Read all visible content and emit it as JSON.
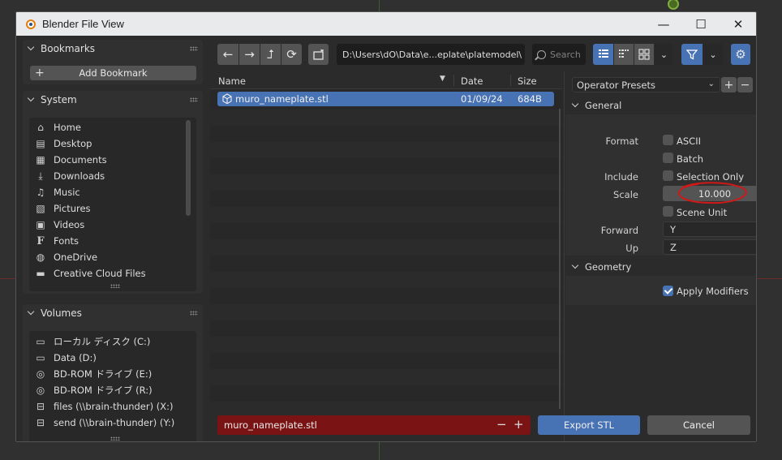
{
  "window": {
    "title": "Blender File View",
    "minimize": "—",
    "maximize": "☐",
    "close": "✕"
  },
  "colors": {
    "accent": "#4772b3",
    "filename_error_bg": "#7a1414",
    "panel_bg": "#303030",
    "annotation_circle": "#d01818"
  },
  "bookmarks": {
    "header": "Bookmarks",
    "add_label": "Add Bookmark"
  },
  "system": {
    "header": "System",
    "items": [
      {
        "label": "Home",
        "icon": "home-icon"
      },
      {
        "label": "Desktop",
        "icon": "desktop-icon"
      },
      {
        "label": "Documents",
        "icon": "documents-icon"
      },
      {
        "label": "Downloads",
        "icon": "download-icon"
      },
      {
        "label": "Music",
        "icon": "music-icon"
      },
      {
        "label": "Pictures",
        "icon": "pictures-icon"
      },
      {
        "label": "Videos",
        "icon": "videos-icon"
      },
      {
        "label": "Fonts",
        "icon": "font-icon"
      },
      {
        "label": "OneDrive",
        "icon": "globe-icon"
      },
      {
        "label": "Creative Cloud Files",
        "icon": "folder-icon"
      }
    ]
  },
  "volumes": {
    "header": "Volumes",
    "items": [
      {
        "label": "ローカル ディスク (C:)",
        "icon": "disk-icon"
      },
      {
        "label": "Data (D:)",
        "icon": "disk-icon"
      },
      {
        "label": "BD-ROM ドライブ (E:)",
        "icon": "disc-icon"
      },
      {
        "label": "BD-ROM ドライブ (R:)",
        "icon": "disc-icon"
      },
      {
        "label": "files (\\\\brain-thunder) (X:)",
        "icon": "network-drive-icon"
      },
      {
        "label": "send (\\\\brain-thunder) (Y:)",
        "icon": "network-drive-icon"
      }
    ]
  },
  "toolbar": {
    "back": "←",
    "forward": "→",
    "parent": "⮥",
    "refresh": "⟳",
    "path": "D:\\Users\\dO\\Data\\e...eplate\\platemodel\\",
    "search_placeholder": "Search"
  },
  "file_list": {
    "columns": {
      "name": "Name",
      "date": "Date",
      "size": "Size"
    },
    "files": [
      {
        "name": "muro_nameplate.stl",
        "date": "01/09/24",
        "size": "684B"
      }
    ]
  },
  "options": {
    "presets_label": "Operator Presets",
    "general_header": "General",
    "format_label": "Format",
    "ascii_label": "ASCII",
    "ascii_checked": false,
    "batch_label": "Batch",
    "batch_checked": false,
    "include_label": "Include",
    "selection_only_label": "Selection Only",
    "selection_only_checked": false,
    "scale_label": "Scale",
    "scale_value": "10.000",
    "scene_unit_label": "Scene Unit",
    "scene_unit_checked": false,
    "forward_label": "Forward",
    "forward_value": "Y",
    "up_label": "Up",
    "up_value": "Z",
    "geometry_header": "Geometry",
    "apply_modifiers_label": "Apply Modifiers",
    "apply_modifiers_checked": true
  },
  "footer": {
    "filename": "muro_nameplate.stl",
    "export_label": "Export STL",
    "cancel_label": "Cancel"
  }
}
